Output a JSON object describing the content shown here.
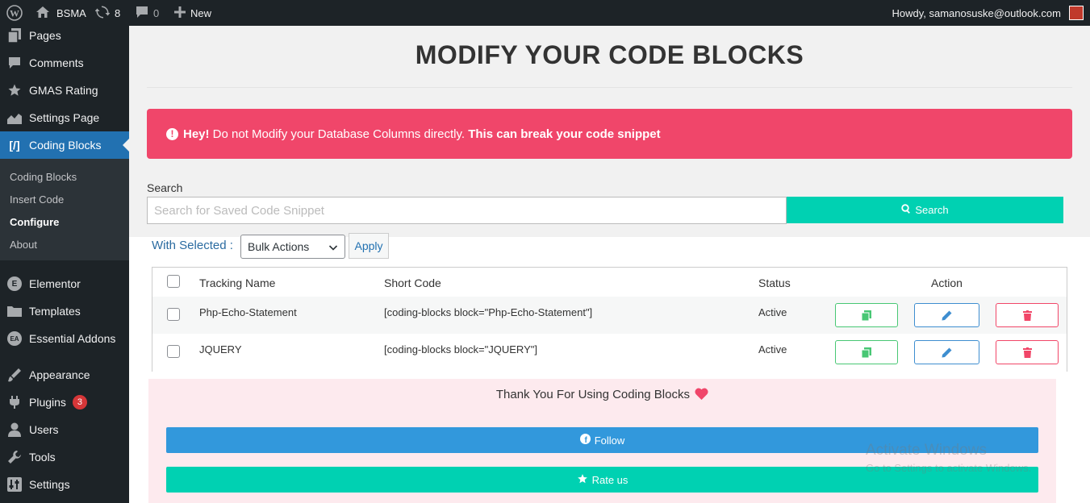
{
  "adminbar": {
    "site_name": "BSMA",
    "updates_count": "8",
    "comments_count": "0",
    "new_label": "New",
    "howdy": "Howdy, samanosuske@outlook.com"
  },
  "sidebar": {
    "items": [
      {
        "label": "Pages",
        "icon": "pages-icon"
      },
      {
        "label": "Comments",
        "icon": "comments-icon"
      },
      {
        "label": "GMAS Rating",
        "icon": "star-icon"
      },
      {
        "label": "Settings Page",
        "icon": "chart-icon"
      },
      {
        "label": "Coding Blocks",
        "icon": "code-icon"
      },
      {
        "label": "Elementor",
        "icon": "elementor-icon"
      },
      {
        "label": "Templates",
        "icon": "folder-icon"
      },
      {
        "label": "Essential Addons",
        "icon": "ea-icon"
      },
      {
        "label": "Appearance",
        "icon": "brush-icon"
      },
      {
        "label": "Plugins",
        "icon": "plugin-icon",
        "badge": "3"
      },
      {
        "label": "Users",
        "icon": "user-icon"
      },
      {
        "label": "Tools",
        "icon": "wrench-icon"
      },
      {
        "label": "Settings",
        "icon": "settings-icon"
      }
    ],
    "submenu": [
      "Coding Blocks",
      "Insert Code",
      "Configure",
      "About"
    ]
  },
  "main": {
    "title": "MODIFY YOUR CODE BLOCKS",
    "warning": {
      "lead": "Hey!",
      "text": " Do not Modify your Database Columns directly. ",
      "emphasis": "This can break your code snippet"
    },
    "search": {
      "label": "Search",
      "placeholder": "Search for Saved Code Snippet",
      "button": "Search"
    },
    "bulk": {
      "with_selected": "With Selected :",
      "selected_option": "Bulk Actions",
      "apply": "Apply"
    },
    "table": {
      "headers": [
        "Tracking Name",
        "Short Code",
        "Status",
        "Action"
      ],
      "rows": [
        {
          "name": "Php-Echo-Statement",
          "shortcode": "[coding-blocks block=\"Php-Echo-Statement\"]",
          "status": "Active"
        },
        {
          "name": "JQUERY",
          "shortcode": "[coding-blocks block=\"JQUERY\"]",
          "status": "Active"
        }
      ]
    },
    "thanks": {
      "text": "Thank You For Using Coding Blocks",
      "follow": "Follow",
      "rate": "Rate us"
    }
  },
  "watermark": {
    "title": "Activate Windows",
    "subtitle": "Go to Settings to activate Windows."
  },
  "colors": {
    "accent": "#2271b1",
    "warning": "#f0466a",
    "teal": "#00d1b2",
    "facebook_blue": "#3298dc"
  }
}
